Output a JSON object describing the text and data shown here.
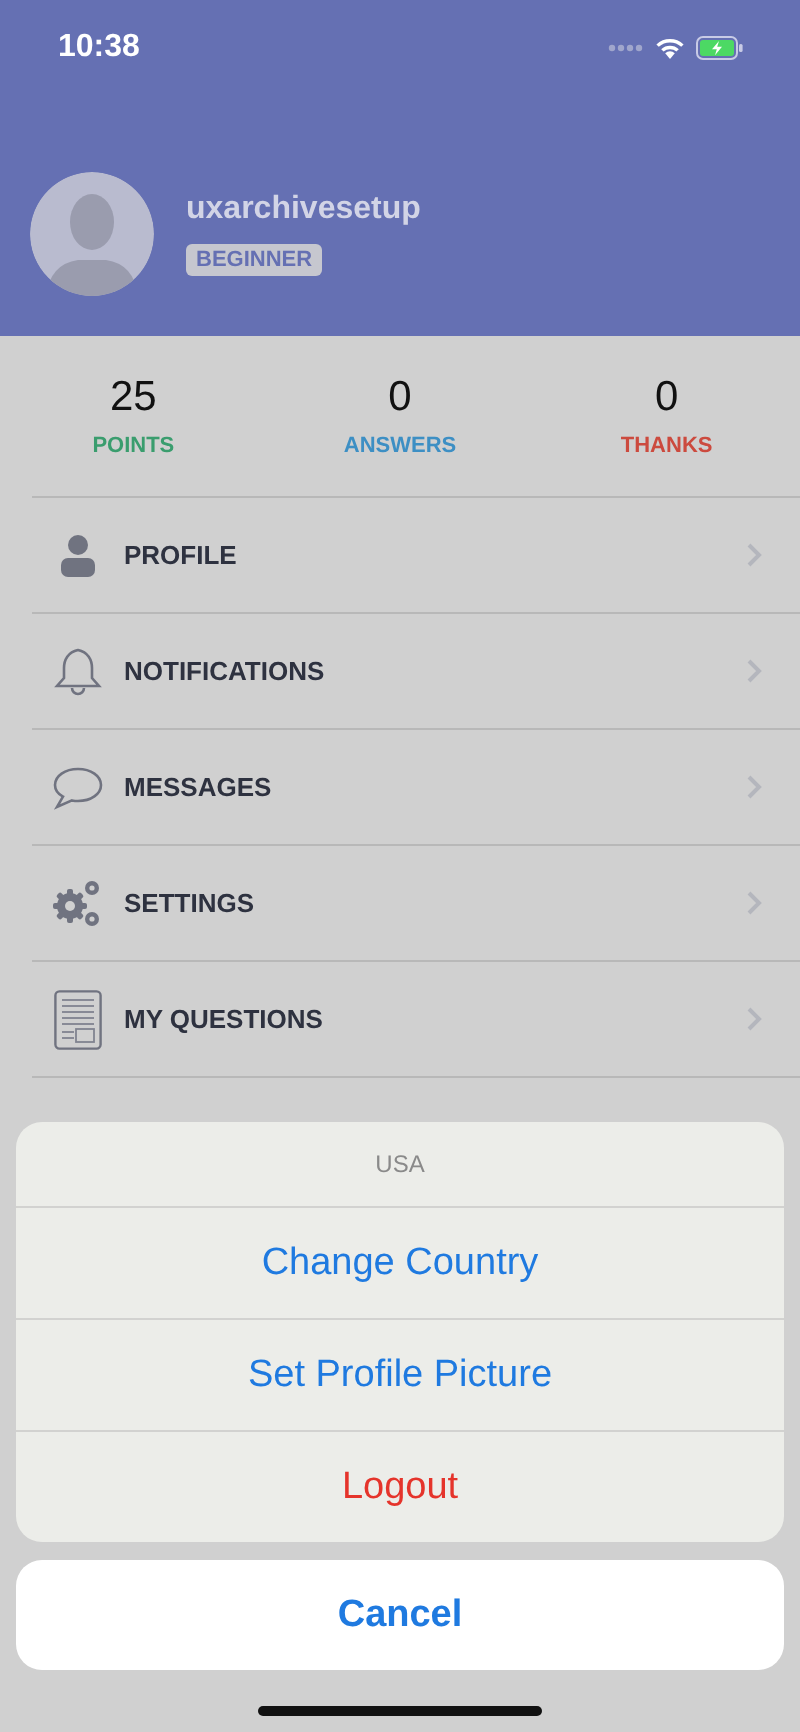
{
  "status_bar": {
    "time": "10:38"
  },
  "profile": {
    "username": "uxarchivesetup",
    "rank_badge": "BEGINNER"
  },
  "stats": [
    {
      "value": "25",
      "label": "POINTS",
      "color": "#3a9d6e"
    },
    {
      "value": "0",
      "label": "ANSWERS",
      "color": "#3d8fc4"
    },
    {
      "value": "0",
      "label": "THANKS",
      "color": "#cc4a3e"
    }
  ],
  "menu": [
    {
      "label": "PROFILE"
    },
    {
      "label": "NOTIFICATIONS"
    },
    {
      "label": "MESSAGES"
    },
    {
      "label": "SETTINGS"
    },
    {
      "label": "MY QUESTIONS"
    }
  ],
  "action_sheet": {
    "title": "USA",
    "actions": [
      {
        "label": "Change Country",
        "kind": "default"
      },
      {
        "label": "Set Profile Picture",
        "kind": "default"
      },
      {
        "label": "Logout",
        "kind": "destructive"
      }
    ],
    "cancel": "Cancel"
  }
}
